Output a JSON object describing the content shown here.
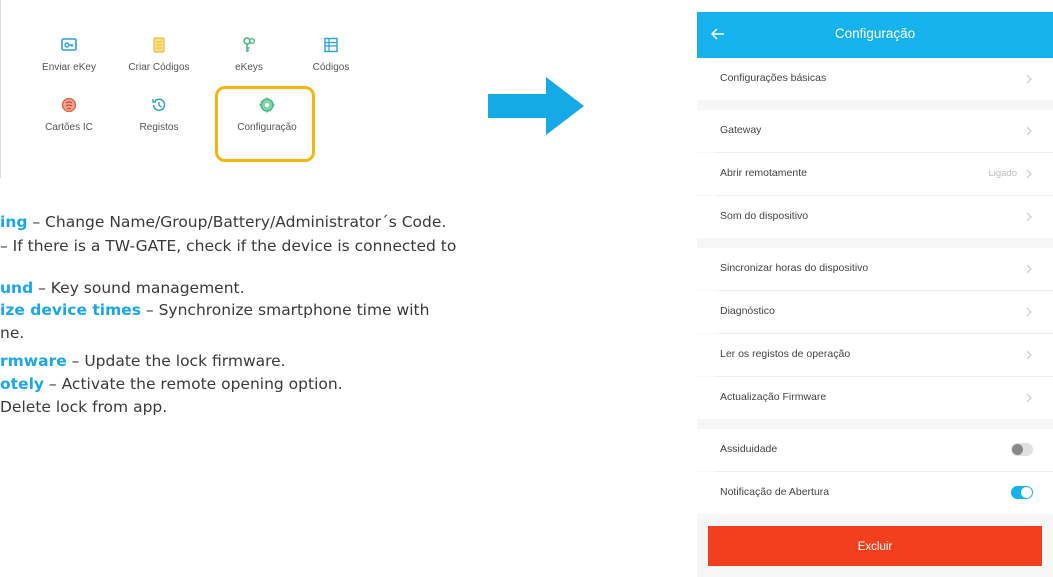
{
  "app_grid": {
    "items": [
      {
        "label": "Enviar eKey",
        "icon": "send-ekey-icon"
      },
      {
        "label": "Criar Códigos",
        "icon": "create-codes-icon"
      },
      {
        "label": "eKeys",
        "icon": "ekeys-icon"
      },
      {
        "label": "Códigos",
        "icon": "codes-icon"
      },
      {
        "label": "Cartões IC",
        "icon": "ic-cards-icon"
      },
      {
        "label": "Registos",
        "icon": "records-icon"
      },
      {
        "label": "Configuração",
        "icon": "settings-icon"
      }
    ],
    "highlight_color": "#f5b50c"
  },
  "description": {
    "lines": [
      {
        "keyword": "ing",
        "text": " – Change Name/Group/Battery/Administrator´s Code."
      },
      {
        "keyword": "",
        "text": "– If there is a TW-GATE, check if the device is connected to"
      },
      {
        "keyword": "und",
        "text": " – Key sound management."
      },
      {
        "keyword": "ize device times",
        "text": " – Synchronize smartphone time with"
      },
      {
        "keyword": "",
        "text": "ne."
      },
      {
        "keyword": "rmware",
        "text": " – Update the lock firmware."
      },
      {
        "keyword": "otely",
        "text": " – Activate the remote opening option."
      },
      {
        "keyword": "",
        "text": "Delete lock from app."
      }
    ],
    "keyword_color": "#1aa7e6"
  },
  "arrow_color": "#15a9e6",
  "phone": {
    "header": {
      "title": "Configuração",
      "back_icon": "back-arrow-icon",
      "color": "#15b2ee"
    },
    "settings": [
      {
        "label": "Configurações básicas",
        "type": "chevron"
      },
      {
        "label": "Gateway",
        "type": "chevron"
      },
      {
        "label": "Abrir remotamente",
        "type": "chevron",
        "value": "Ligado"
      },
      {
        "label": "Som do dispositivo",
        "type": "chevron"
      },
      {
        "label": "Sincronizar horas do dispositivo",
        "type": "chevron"
      },
      {
        "label": "Diagnóstico",
        "type": "chevron"
      },
      {
        "label": "Ler os registos de operação",
        "type": "chevron"
      },
      {
        "label": "Actualização Firmware",
        "type": "chevron"
      },
      {
        "label": "Assiduidade",
        "type": "toggle",
        "on": false
      },
      {
        "label": "Notificação de Abertura",
        "type": "toggle",
        "on": true
      }
    ],
    "delete_button": {
      "label": "Excluir",
      "color": "#f23f1e"
    }
  }
}
